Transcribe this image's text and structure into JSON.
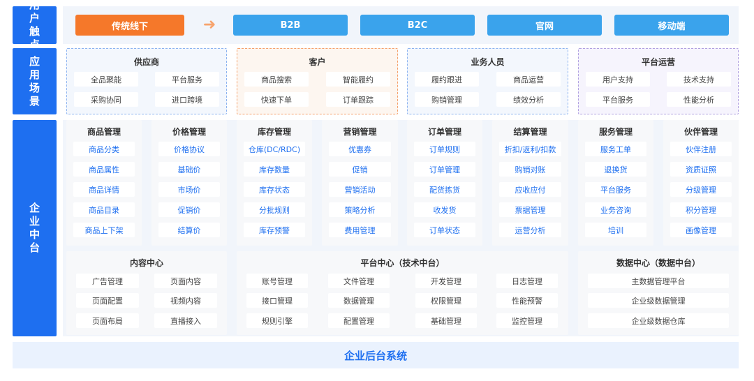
{
  "side_labels": {
    "touch": "用户触点",
    "scene": "应用场景",
    "center": "企业中台"
  },
  "touch": {
    "primary": "传统线下",
    "arrow": "➜",
    "channels": [
      "B2B",
      "B2C",
      "官网",
      "移动端"
    ]
  },
  "scenes": [
    {
      "title": "供应商",
      "items": [
        "全品聚能",
        "平台服务",
        "采购协同",
        "进口跨境"
      ]
    },
    {
      "title": "客户",
      "items": [
        "商品搜索",
        "智能履约",
        "快速下单",
        "订单跟踪"
      ]
    },
    {
      "title": "业务人员",
      "items": [
        "履约跟进",
        "商品运营",
        "购销管理",
        "绩效分析"
      ]
    },
    {
      "title": "平台运营",
      "items": [
        "用户支持",
        "技术支持",
        "平台服务",
        "性能分析"
      ]
    }
  ],
  "modules": [
    {
      "title": "商品管理",
      "items": [
        "商品分类",
        "商品属性",
        "商品详情",
        "商品目录",
        "商品上下架"
      ]
    },
    {
      "title": "价格管理",
      "items": [
        "价格协议",
        "基础价",
        "市场价",
        "促销价",
        "结算价"
      ]
    },
    {
      "title": "库存管理",
      "items": [
        "仓库(DC/RDC)",
        "库存数量",
        "库存状态",
        "分批规则",
        "库存预警"
      ]
    },
    {
      "title": "营销管理",
      "items": [
        "优惠券",
        "促销",
        "营销活动",
        "策略分析",
        "费用管理"
      ]
    },
    {
      "title": "订单管理",
      "items": [
        "订单规则",
        "订单管理",
        "配货拣货",
        "收发货",
        "订单状态"
      ]
    },
    {
      "title": "结算管理",
      "items": [
        "折扣/返利/扣款",
        "购销对账",
        "应收应付",
        "票据管理",
        "运营分析"
      ]
    },
    {
      "title": "服务管理",
      "items": [
        "服务工单",
        "退换货",
        "平台服务",
        "业务咨询",
        "培训"
      ]
    },
    {
      "title": "伙伴管理",
      "items": [
        "伙伴注册",
        "资质证照",
        "分级管理",
        "积分管理",
        "画像管理"
      ]
    }
  ],
  "centers": {
    "content": {
      "title": "内容中心",
      "items": [
        "广告管理",
        "页面内容",
        "页面配置",
        "视频内容",
        "页面布局",
        "直播接入"
      ]
    },
    "platform": {
      "title": "平台中心（技术中台）",
      "items": [
        "账号管理",
        "文件管理",
        "开发管理",
        "日志管理",
        "接口管理",
        "数据管理",
        "权限管理",
        "性能预警",
        "规则引擎",
        "配置管理",
        "基础管理",
        "监控管理"
      ]
    },
    "data": {
      "title": "数据中心（数据中台）",
      "items": [
        "主数据管理平台",
        "企业级数据管理",
        "企业级数据仓库"
      ]
    }
  },
  "bottom": "企业后台系统"
}
